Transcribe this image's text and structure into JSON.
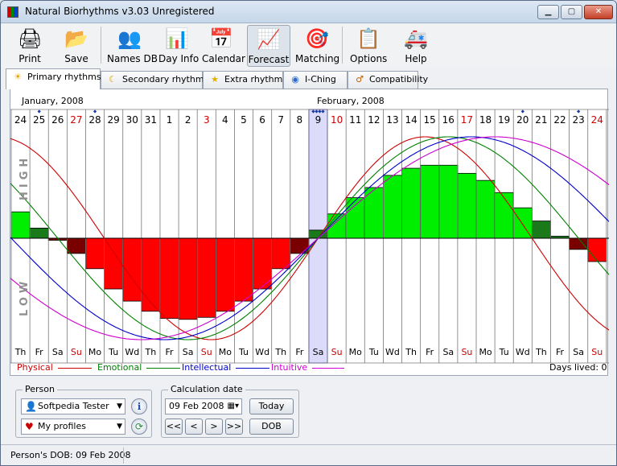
{
  "window": {
    "title": "Natural Biorhythms v3.03 Unregistered"
  },
  "toolbar": [
    {
      "id": "print",
      "label": "Print",
      "icon": "printer-icon",
      "glyph": "🖨"
    },
    {
      "id": "save",
      "label": "Save",
      "icon": "folder-save-icon",
      "glyph": "📂"
    },
    {
      "id": "names_db",
      "label": "Names DB",
      "icon": "people-icon",
      "glyph": "👥"
    },
    {
      "id": "day_info",
      "label": "Day Info",
      "icon": "day-info-icon",
      "glyph": "📊"
    },
    {
      "id": "calendar",
      "label": "Calendar",
      "icon": "calendar-icon",
      "glyph": "📅"
    },
    {
      "id": "forecast",
      "label": "Forecast",
      "icon": "forecast-icon",
      "glyph": "📈"
    },
    {
      "id": "matching",
      "label": "Matching",
      "icon": "matching-icon",
      "glyph": "🎯"
    },
    {
      "id": "options",
      "label": "Options",
      "icon": "options-icon",
      "glyph": "📋"
    },
    {
      "id": "help",
      "label": "Help",
      "icon": "help-icon",
      "glyph": "🚑"
    }
  ],
  "tabs": [
    {
      "label": "Primary rhythms",
      "icon": "sun-icon",
      "glyph": "☀",
      "active": true
    },
    {
      "label": "Secondary rhythms",
      "icon": "moon-icon",
      "glyph": "☾",
      "active": false
    },
    {
      "label": "Extra rhythms",
      "icon": "star-icon",
      "glyph": "★",
      "active": false
    },
    {
      "label": "I-Ching",
      "icon": "globe-icon",
      "glyph": "◉",
      "active": false
    },
    {
      "label": "Compatibility",
      "icon": "compatibility-icon",
      "glyph": "♂",
      "active": false
    }
  ],
  "chart_data": {
    "type": "line",
    "month_labels": [
      "January, 2008",
      "February, 2008"
    ],
    "y_high_label": "HIGH",
    "y_low_label": "LOW",
    "days": [
      "24",
      "25",
      "26",
      "27",
      "28",
      "29",
      "30",
      "31",
      "1",
      "2",
      "3",
      "4",
      "5",
      "6",
      "7",
      "8",
      "9",
      "10",
      "11",
      "12",
      "13",
      "14",
      "15",
      "16",
      "17",
      "18",
      "19",
      "20",
      "21",
      "22",
      "23",
      "24"
    ],
    "weekdays": [
      "Th",
      "Fr",
      "Sa",
      "Su",
      "Mo",
      "Tu",
      "Wd",
      "Th",
      "Fr",
      "Sa",
      "Su",
      "Mo",
      "Tu",
      "Wd",
      "Th",
      "Fr",
      "Sa",
      "Su",
      "Mo",
      "Tu",
      "Wd",
      "Th",
      "Fr",
      "Sa",
      "Su",
      "Mo",
      "Tu",
      "Wd",
      "Th",
      "Fr",
      "Sa",
      "Su"
    ],
    "red_days": [
      3,
      10,
      17,
      24,
      31
    ],
    "dot_marks": {
      "1": 1,
      "4": 1,
      "16": 4,
      "27": 1,
      "30": 1
    },
    "selected_index": 16,
    "bars": [
      0.26,
      0.1,
      -0.02,
      -0.15,
      -0.3,
      -0.5,
      -0.62,
      -0.72,
      -0.79,
      -0.8,
      -0.78,
      -0.72,
      -0.62,
      -0.5,
      -0.3,
      -0.15,
      0.08,
      0.24,
      0.4,
      0.5,
      0.62,
      0.69,
      0.72,
      0.72,
      0.64,
      0.57,
      0.45,
      0.3,
      0.17,
      0.02,
      -0.11,
      -0.23
    ],
    "series": [
      {
        "name": "Physical",
        "color": "#d00000",
        "period": 23
      },
      {
        "name": "Emotional",
        "color": "#008000",
        "period": 28
      },
      {
        "name": "Intellectual",
        "color": "#0000cc",
        "period": 33
      },
      {
        "name": "Intuitive",
        "color": "#cc00cc",
        "period": 38
      }
    ],
    "ylim": [
      -1,
      1
    ]
  },
  "days_lived": "Days lived: 0",
  "person": {
    "group_title": "Person",
    "name": "Softpedia Tester",
    "profiles": "My profiles"
  },
  "calc": {
    "group_title": "Calculation date",
    "date": "09 Feb 2008",
    "today_label": "Today",
    "dob_label": "DOB",
    "nav": [
      "<<",
      "<",
      ">",
      ">>"
    ]
  },
  "status": {
    "text": "Person's DOB: 09 Feb 2008"
  }
}
